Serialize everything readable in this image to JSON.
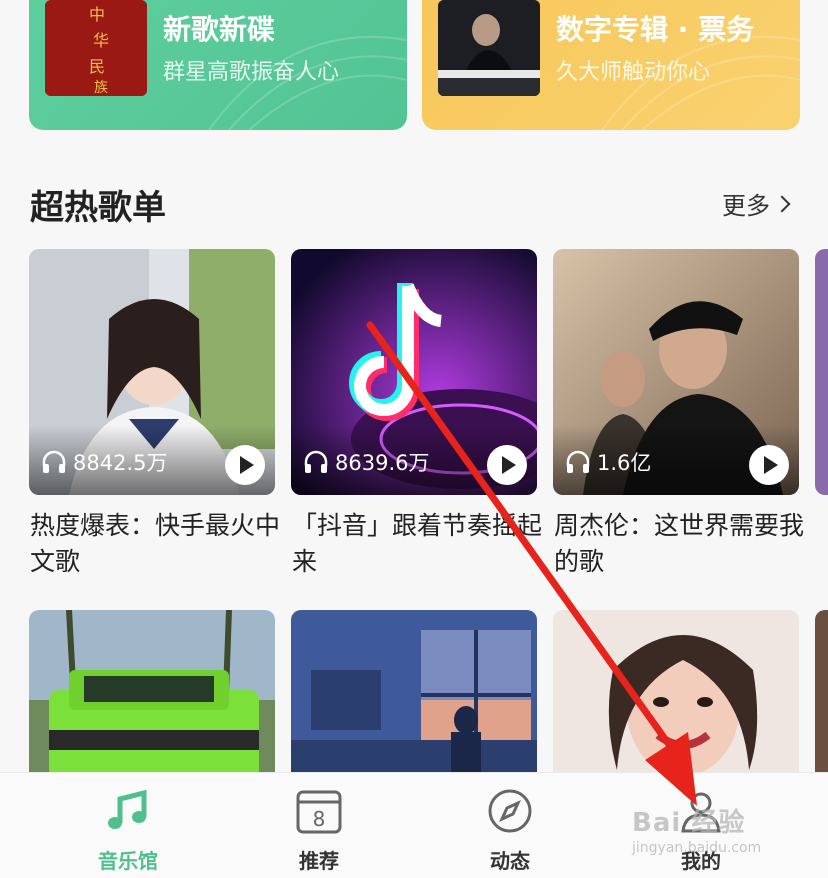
{
  "promos": [
    {
      "title": "新歌新碟",
      "subtitle": "群星高歌振奋人心"
    },
    {
      "title": "数字专辑 · 票务",
      "subtitle": "久大师触动你心"
    }
  ],
  "section": {
    "title": "超热歌单",
    "more": "更多"
  },
  "playlists": [
    {
      "plays": "8842.5万",
      "title": "热度爆表：快手最火中文歌"
    },
    {
      "plays": "8639.6万",
      "title": "「抖音」跟着节奏摇起来"
    },
    {
      "plays": "1.6亿",
      "title": "周杰伦：这世界需要我的歌"
    }
  ],
  "nav": [
    {
      "label": "音乐馆",
      "icon": "music-note-icon"
    },
    {
      "label": "推荐",
      "icon": "calendar-icon"
    },
    {
      "label": "动态",
      "icon": "compass-icon"
    },
    {
      "label": "我的",
      "icon": "user-icon"
    }
  ],
  "calendar_day": "8",
  "watermark": {
    "main": "Bai 经验",
    "sub": "jingyan.baidu.com"
  },
  "colors": {
    "accent": "#4fc08d",
    "green_card": "#56c698",
    "yellow_card": "#f8cb62",
    "arrow": "#e8231b"
  }
}
